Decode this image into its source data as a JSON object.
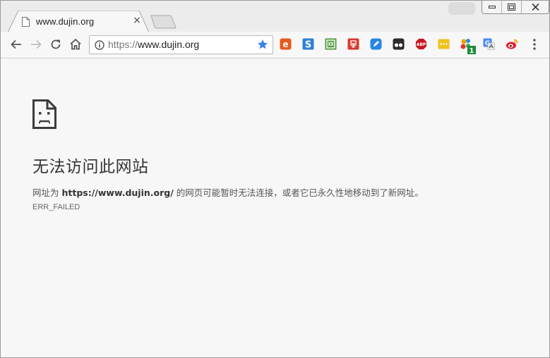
{
  "tab": {
    "title": "www.dujin.org",
    "favicon": "page-icon",
    "close_glyph": "×"
  },
  "window_controls": {
    "minimize": "minimize-icon",
    "restore": "restore-icon",
    "close": "close-icon"
  },
  "toolbar": {
    "back": "back-arrow-icon",
    "forward": "forward-arrow-icon",
    "reload": "reload-icon",
    "home": "home-icon",
    "address": {
      "scheme": "https://",
      "host": "www.dujin.org",
      "info_icon": "info-icon",
      "bookmark_icon": "star-icon"
    },
    "extensions": [
      {
        "name": "ext-orange-icon",
        "glyph": "e",
        "bg": "#e8591f"
      },
      {
        "name": "ext-sogou-icon",
        "glyph": "S",
        "bg": "#2f7fd6"
      },
      {
        "name": "ext-wang-icon",
        "glyph": "网",
        "bg": "#4e9a3a"
      },
      {
        "name": "ext-red-icon",
        "glyph": "易",
        "bg": "#d43a2e"
      },
      {
        "name": "ext-blue-icon",
        "glyph": "✎",
        "bg": "#2a86e3"
      },
      {
        "name": "ext-tampermonkey-icon",
        "glyph": "●●",
        "bg": "#2b2b2b"
      },
      {
        "name": "ext-abp-icon",
        "glyph": "ABP",
        "bg": "#c7161d"
      },
      {
        "name": "ext-yellow-icon",
        "glyph": "•••",
        "bg": "#f0c21a"
      },
      {
        "name": "ext-colorful-icon",
        "glyph": "",
        "bg": "transparent",
        "badge": "1"
      },
      {
        "name": "ext-translate-icon",
        "glyph": "G",
        "bg": "#4a8af4"
      },
      {
        "name": "ext-weibo-icon",
        "glyph": "",
        "bg": "transparent"
      }
    ],
    "menu": "menu-dots-icon"
  },
  "error": {
    "icon": "sad-page-icon",
    "title": "无法访问此网站",
    "desc_prefix": "网址为 ",
    "desc_url": "https://www.dujin.org/",
    "desc_suffix": " 的网页可能暂时无法连接，或者它已永久性地移动到了新网址。",
    "code": "ERR_FAILED"
  },
  "colors": {
    "accent_star": "#3b82e6",
    "content_bg": "#f7f7f7"
  }
}
